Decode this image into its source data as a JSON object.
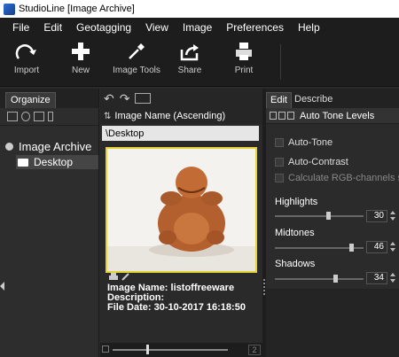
{
  "window": {
    "title": "StudioLine [Image Archive]"
  },
  "menu": [
    "File",
    "Edit",
    "Geotagging",
    "View",
    "Image",
    "Preferences",
    "Help"
  ],
  "toolbar": {
    "import": "Import",
    "new": "New",
    "image_tools": "Image Tools",
    "share": "Share",
    "print": "Print"
  },
  "left_panel": {
    "tab": "Organize",
    "tree_root": "Image Archive",
    "tree_child": "Desktop"
  },
  "middle_panel": {
    "sort_label": "Image Name (Ascending)",
    "path": "\\Desktop",
    "meta": {
      "name_label": "Image Name:",
      "name_value": "listoffreeware",
      "desc_label": "Description:",
      "desc_value": "",
      "date_label": "File Date:",
      "date_value": "30-10-2017 16:18:50"
    },
    "zoom_value": "2"
  },
  "right_panel": {
    "tab_edit": "Edit",
    "tab_describe": "Describe",
    "tool_title": "Auto Tone Levels",
    "auto_tone": "Auto-Tone",
    "auto_contrast": "Auto-Contrast",
    "calc_rgb": "Calculate RGB-channels se",
    "highlights_label": "Highlights",
    "highlights_value": "30",
    "midtones_label": "Midtones",
    "midtones_value": "46",
    "shadows_label": "Shadows",
    "shadows_value": "34"
  }
}
